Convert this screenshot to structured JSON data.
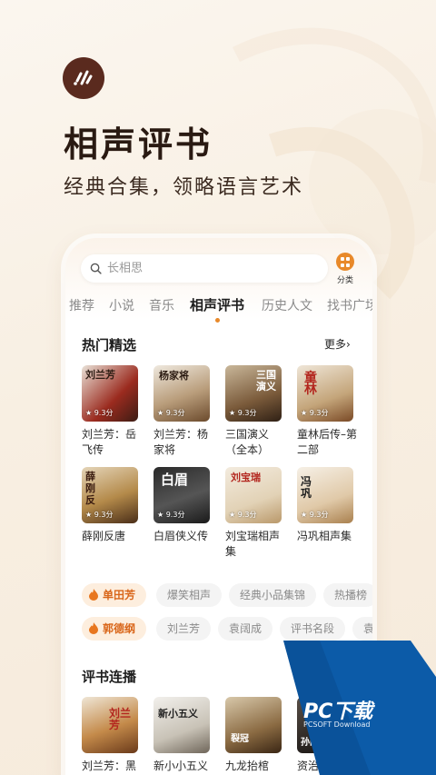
{
  "hero": {
    "title": "相声评书",
    "subtitle": "经典合集，领略语言艺术"
  },
  "search": {
    "placeholder": "长相思",
    "category_label": "分类"
  },
  "tabs": [
    {
      "label": "推荐",
      "active": false
    },
    {
      "label": "小说",
      "active": false
    },
    {
      "label": "音乐",
      "active": false
    },
    {
      "label": "相声评书",
      "active": true
    },
    {
      "label": "历史人文",
      "active": false
    },
    {
      "label": "找书广场",
      "active": false
    }
  ],
  "hot": {
    "title": "热门精选",
    "more": "更多›",
    "items": [
      {
        "title": "刘兰芳：岳飞传",
        "rating": "★ 9.3分",
        "cover_text": "刘兰芳"
      },
      {
        "title": "刘兰芳：杨家将",
        "rating": "★ 9.3分",
        "cover_text": "杨家将"
      },
      {
        "title": "三国演义（全本）",
        "rating": "★ 9.3分",
        "cover_text": "三国演义"
      },
      {
        "title": "童林后传–第二部",
        "rating": "★ 9.3分",
        "cover_text": "童林"
      },
      {
        "title": "薛刚反唐",
        "rating": "★ 9.3分",
        "cover_text": "薛刚反"
      },
      {
        "title": "白眉侠义传",
        "rating": "★ 9.3分",
        "cover_text": "白眉"
      },
      {
        "title": "刘宝瑞相声集",
        "rating": "★ 9.3分",
        "cover_text": "刘宝瑞"
      },
      {
        "title": "冯巩相声集",
        "rating": "★ 9.3分",
        "cover_text": "冯巩"
      }
    ]
  },
  "chips_row1": [
    "单田芳",
    "爆笑相声",
    "经典小品集锦",
    "热播榜"
  ],
  "chips_row2": [
    "郭德纲",
    "刘兰芳",
    "袁阔成",
    "评书名段",
    "袁"
  ],
  "serial": {
    "title": "评书连播",
    "items": [
      {
        "title": "刘兰芳：黑",
        "cover_text": "刘兰芳"
      },
      {
        "title": "新小小五义",
        "cover_text": "新小五义"
      },
      {
        "title": "九龙抬棺",
        "cover_text": "裂冠"
      },
      {
        "title": "资治通鉴",
        "cover_text": "孙刚"
      }
    ]
  },
  "watermark": {
    "brand": "PC下载",
    "sub": "PCSOFT Download"
  },
  "colors": {
    "accent": "#e8892a",
    "brand_dark": "#5a2a1e",
    "chip_hot_text": "#d9661a"
  }
}
